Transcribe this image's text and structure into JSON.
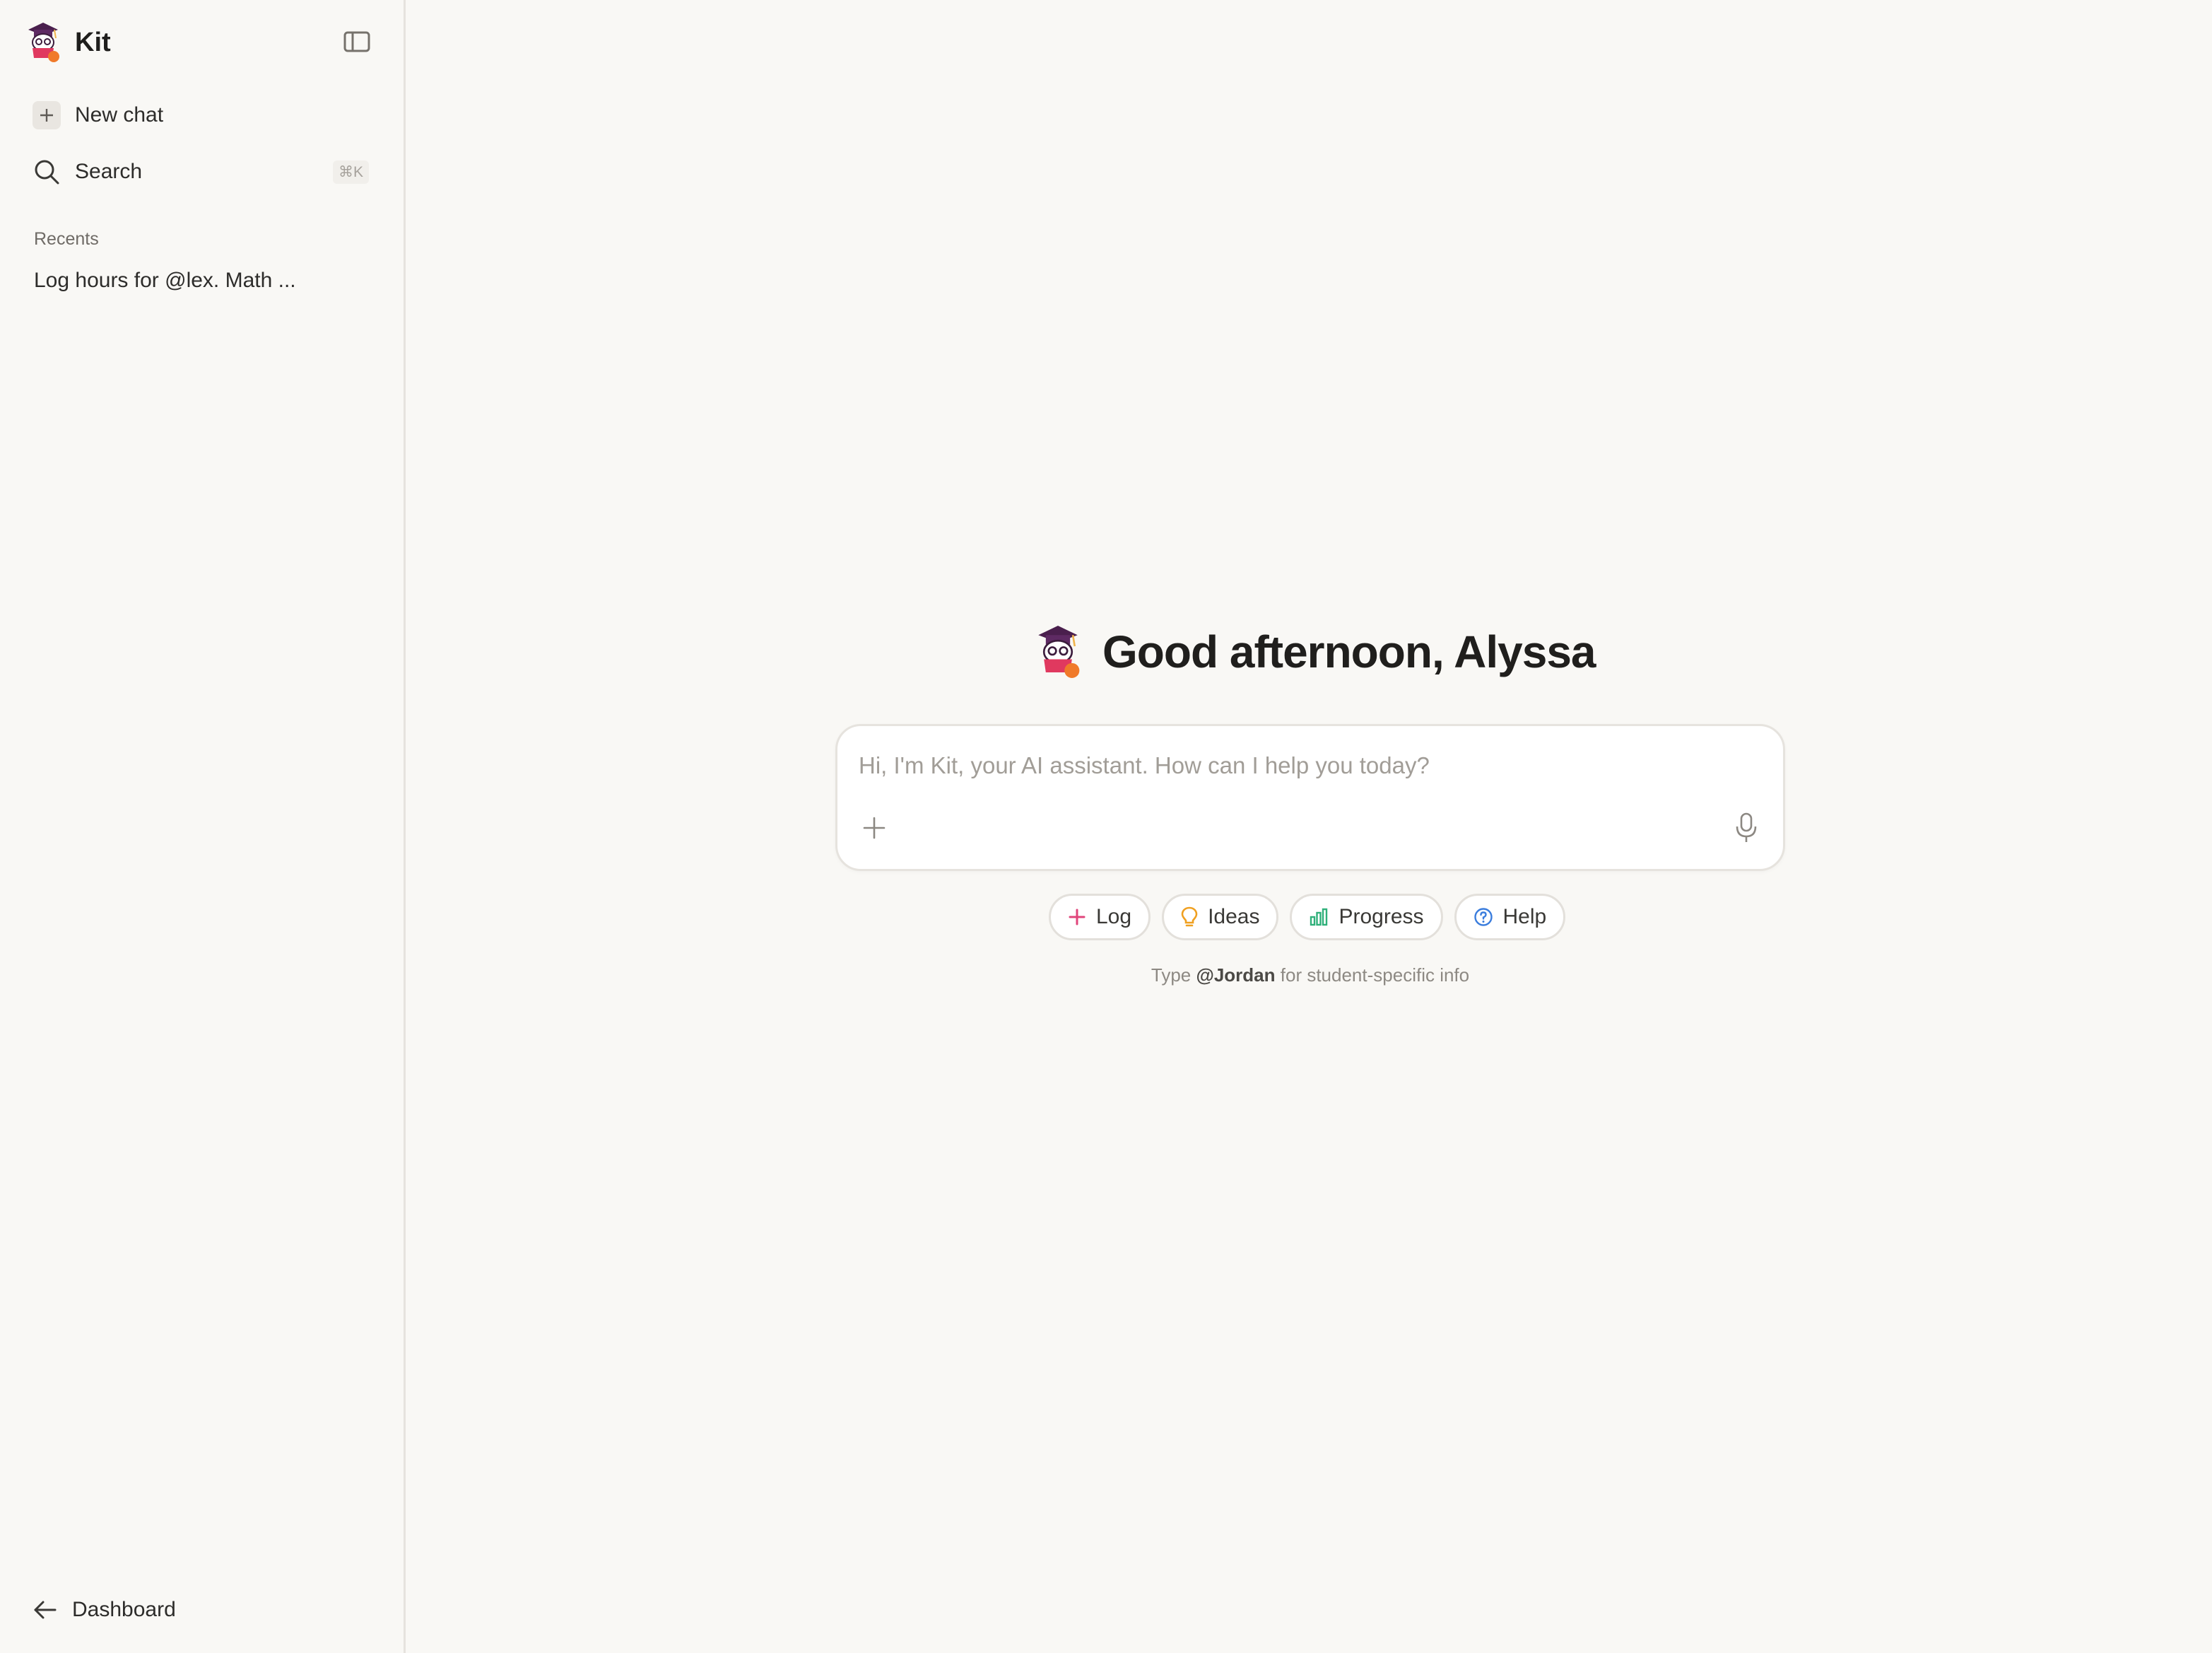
{
  "app": {
    "name": "Kit"
  },
  "sidebar": {
    "new_chat_label": "New chat",
    "search_label": "Search",
    "search_shortcut": "⌘K",
    "recents_title": "Recents",
    "recents": [
      {
        "label": "Log hours for @lex. Math ..."
      }
    ],
    "dashboard_label": "Dashboard"
  },
  "main": {
    "greeting": "Good afternoon, Alyssa",
    "composer": {
      "placeholder": "Hi, I'm Kit, your AI assistant. How can I help you today?",
      "value": ""
    },
    "chips": [
      {
        "label": "Log",
        "icon": "plus-icon",
        "color": "#e0457b"
      },
      {
        "label": "Ideas",
        "icon": "lightbulb-icon",
        "color": "#f0a020"
      },
      {
        "label": "Progress",
        "icon": "bar-chart-icon",
        "color": "#2fb07a"
      },
      {
        "label": "Help",
        "icon": "help-circle-icon",
        "color": "#3b7ddd"
      }
    ],
    "hint": {
      "prefix": "Type",
      "mention": "@Jordan",
      "suffix": "for student-specific info"
    }
  }
}
